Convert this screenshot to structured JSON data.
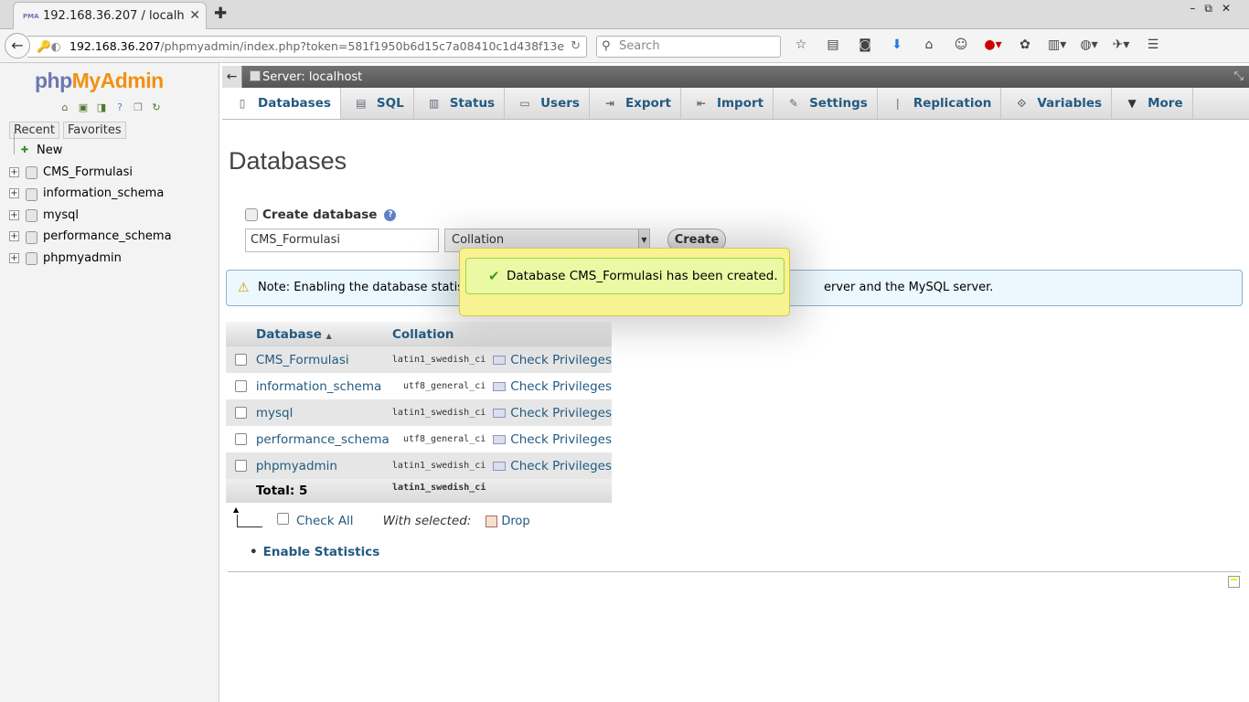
{
  "browser": {
    "tab_title": "192.168.36.207 / localh...",
    "tab_favicon_text": "PMA",
    "url_host": "192.168.36.207",
    "url_rest": "/phpmyadmin/index.php?token=581f1950b6d15c7a08410c1d438f13e",
    "search_placeholder": "Search"
  },
  "pma": {
    "logo_php": "php",
    "logo_myadmin": "MyAdmin",
    "recent_label": "Recent",
    "favorites_label": "Favorites",
    "tree": {
      "new_label": "New",
      "databases": [
        "CMS_Formulasi",
        "information_schema",
        "mysql",
        "performance_schema",
        "phpmyadmin"
      ]
    }
  },
  "server_bar": {
    "label": "Server: localhost"
  },
  "tabs": [
    {
      "label": "Databases",
      "icon": "database-icon"
    },
    {
      "label": "SQL",
      "icon": "sql-icon"
    },
    {
      "label": "Status",
      "icon": "status-icon"
    },
    {
      "label": "Users",
      "icon": "users-icon"
    },
    {
      "label": "Export",
      "icon": "export-icon"
    },
    {
      "label": "Import",
      "icon": "import-icon"
    },
    {
      "label": "Settings",
      "icon": "settings-icon"
    },
    {
      "label": "Replication",
      "icon": "replication-icon"
    },
    {
      "label": "Variables",
      "icon": "variables-icon"
    },
    {
      "label": "More",
      "icon": "chevron-down-icon"
    }
  ],
  "page": {
    "title": "Databases",
    "create_label": "Create database",
    "db_name_value": "CMS_Formulasi",
    "collation_value": "Collation",
    "create_button": "Create",
    "note_part1": "Note: Enabling the database statis",
    "note_part2": "erver and the MySQL server.",
    "table": {
      "headers": {
        "database": "Database",
        "collation": "Collation"
      },
      "rows": [
        {
          "name": "CMS_Formulasi",
          "collation": "latin1_swedish_ci",
          "action": "Check Privileges"
        },
        {
          "name": "information_schema",
          "collation": "utf8_general_ci",
          "action": "Check Privileges"
        },
        {
          "name": "mysql",
          "collation": "latin1_swedish_ci",
          "action": "Check Privileges"
        },
        {
          "name": "performance_schema",
          "collation": "utf8_general_ci",
          "action": "Check Privileges"
        },
        {
          "name": "phpmyadmin",
          "collation": "latin1_swedish_ci",
          "action": "Check Privileges"
        }
      ],
      "total_label": "Total: 5",
      "total_collation": "latin1_swedish_ci"
    },
    "check_all": "Check All",
    "with_selected": "With selected:",
    "drop": "Drop",
    "enable_statistics": "Enable Statistics"
  },
  "toast": {
    "message": "Database CMS_Formulasi has been created."
  },
  "colors": {
    "link": "#235a81",
    "toast_bg": "#f7f292",
    "toast_inner": "#ebf8a4",
    "note_bg": "#ebf8fd"
  }
}
